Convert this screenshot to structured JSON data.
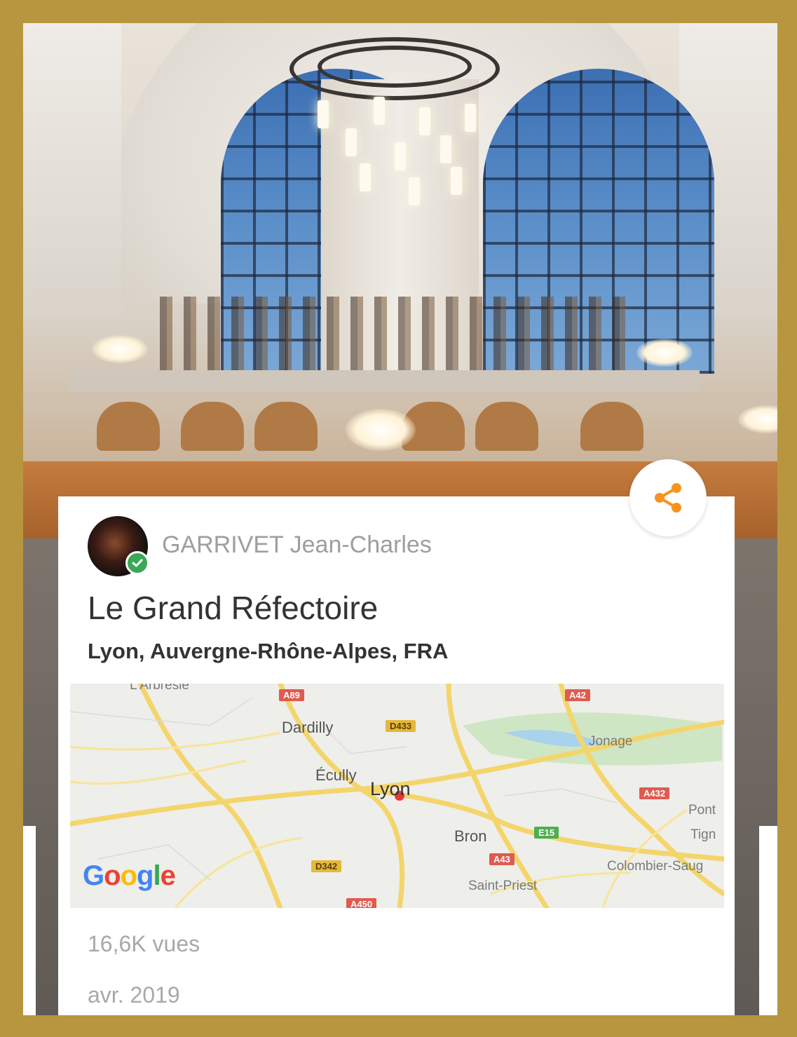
{
  "card": {
    "author": "GARRIVET Jean-Charles",
    "title": "Le Grand Réfectoire",
    "location": "Lyon, Auvergne-Rhône-Alpes, FRA",
    "views": "16,6K vues",
    "date": "avr. 2019"
  },
  "map": {
    "provider_logo": "Google",
    "labels": {
      "dardilly": "Dardilly",
      "ecully": "Écully",
      "lyon": "Lyon",
      "bron": "Bron",
      "jonage": "Jonage",
      "saint_priest": "Saint-Priest",
      "colombier": "Colombier-Saug",
      "pont": "Pont",
      "tign": "Tign",
      "top_left": "L'Arbresle"
    },
    "road_signs": {
      "a89": "A89",
      "a42": "A42",
      "d433": "D433",
      "a432": "A432",
      "e15": "E15",
      "a43": "A43",
      "d342": "D342",
      "a450": "A450"
    }
  },
  "icons": {
    "share": "share-icon",
    "verified": "verified-check-icon",
    "location_pin": "map-pin-icon"
  },
  "colors": {
    "frame": "#b8963f",
    "share_accent": "#f7931e",
    "verified": "#3aa856",
    "pin": "#e53935"
  }
}
